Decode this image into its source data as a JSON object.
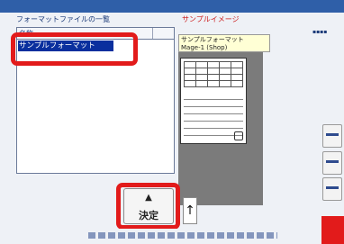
{
  "window": {
    "title": ""
  },
  "list": {
    "caption": "フォーマットファイルの一覧",
    "column_header": "名称",
    "items": [
      {
        "label": "サンプルフォーマット",
        "selected": true
      }
    ]
  },
  "preview": {
    "caption": "サンプルイメージ",
    "title_line1": "サンプルフォーマット",
    "title_line2": "Mage-1 (Shop)"
  },
  "buttons": {
    "confirm_label": "決定",
    "arrow_glyph": "↑"
  },
  "colors": {
    "highlight": "#e21b1b",
    "selection": "#0a2f9e",
    "title_bar": "#2f5fa8"
  }
}
